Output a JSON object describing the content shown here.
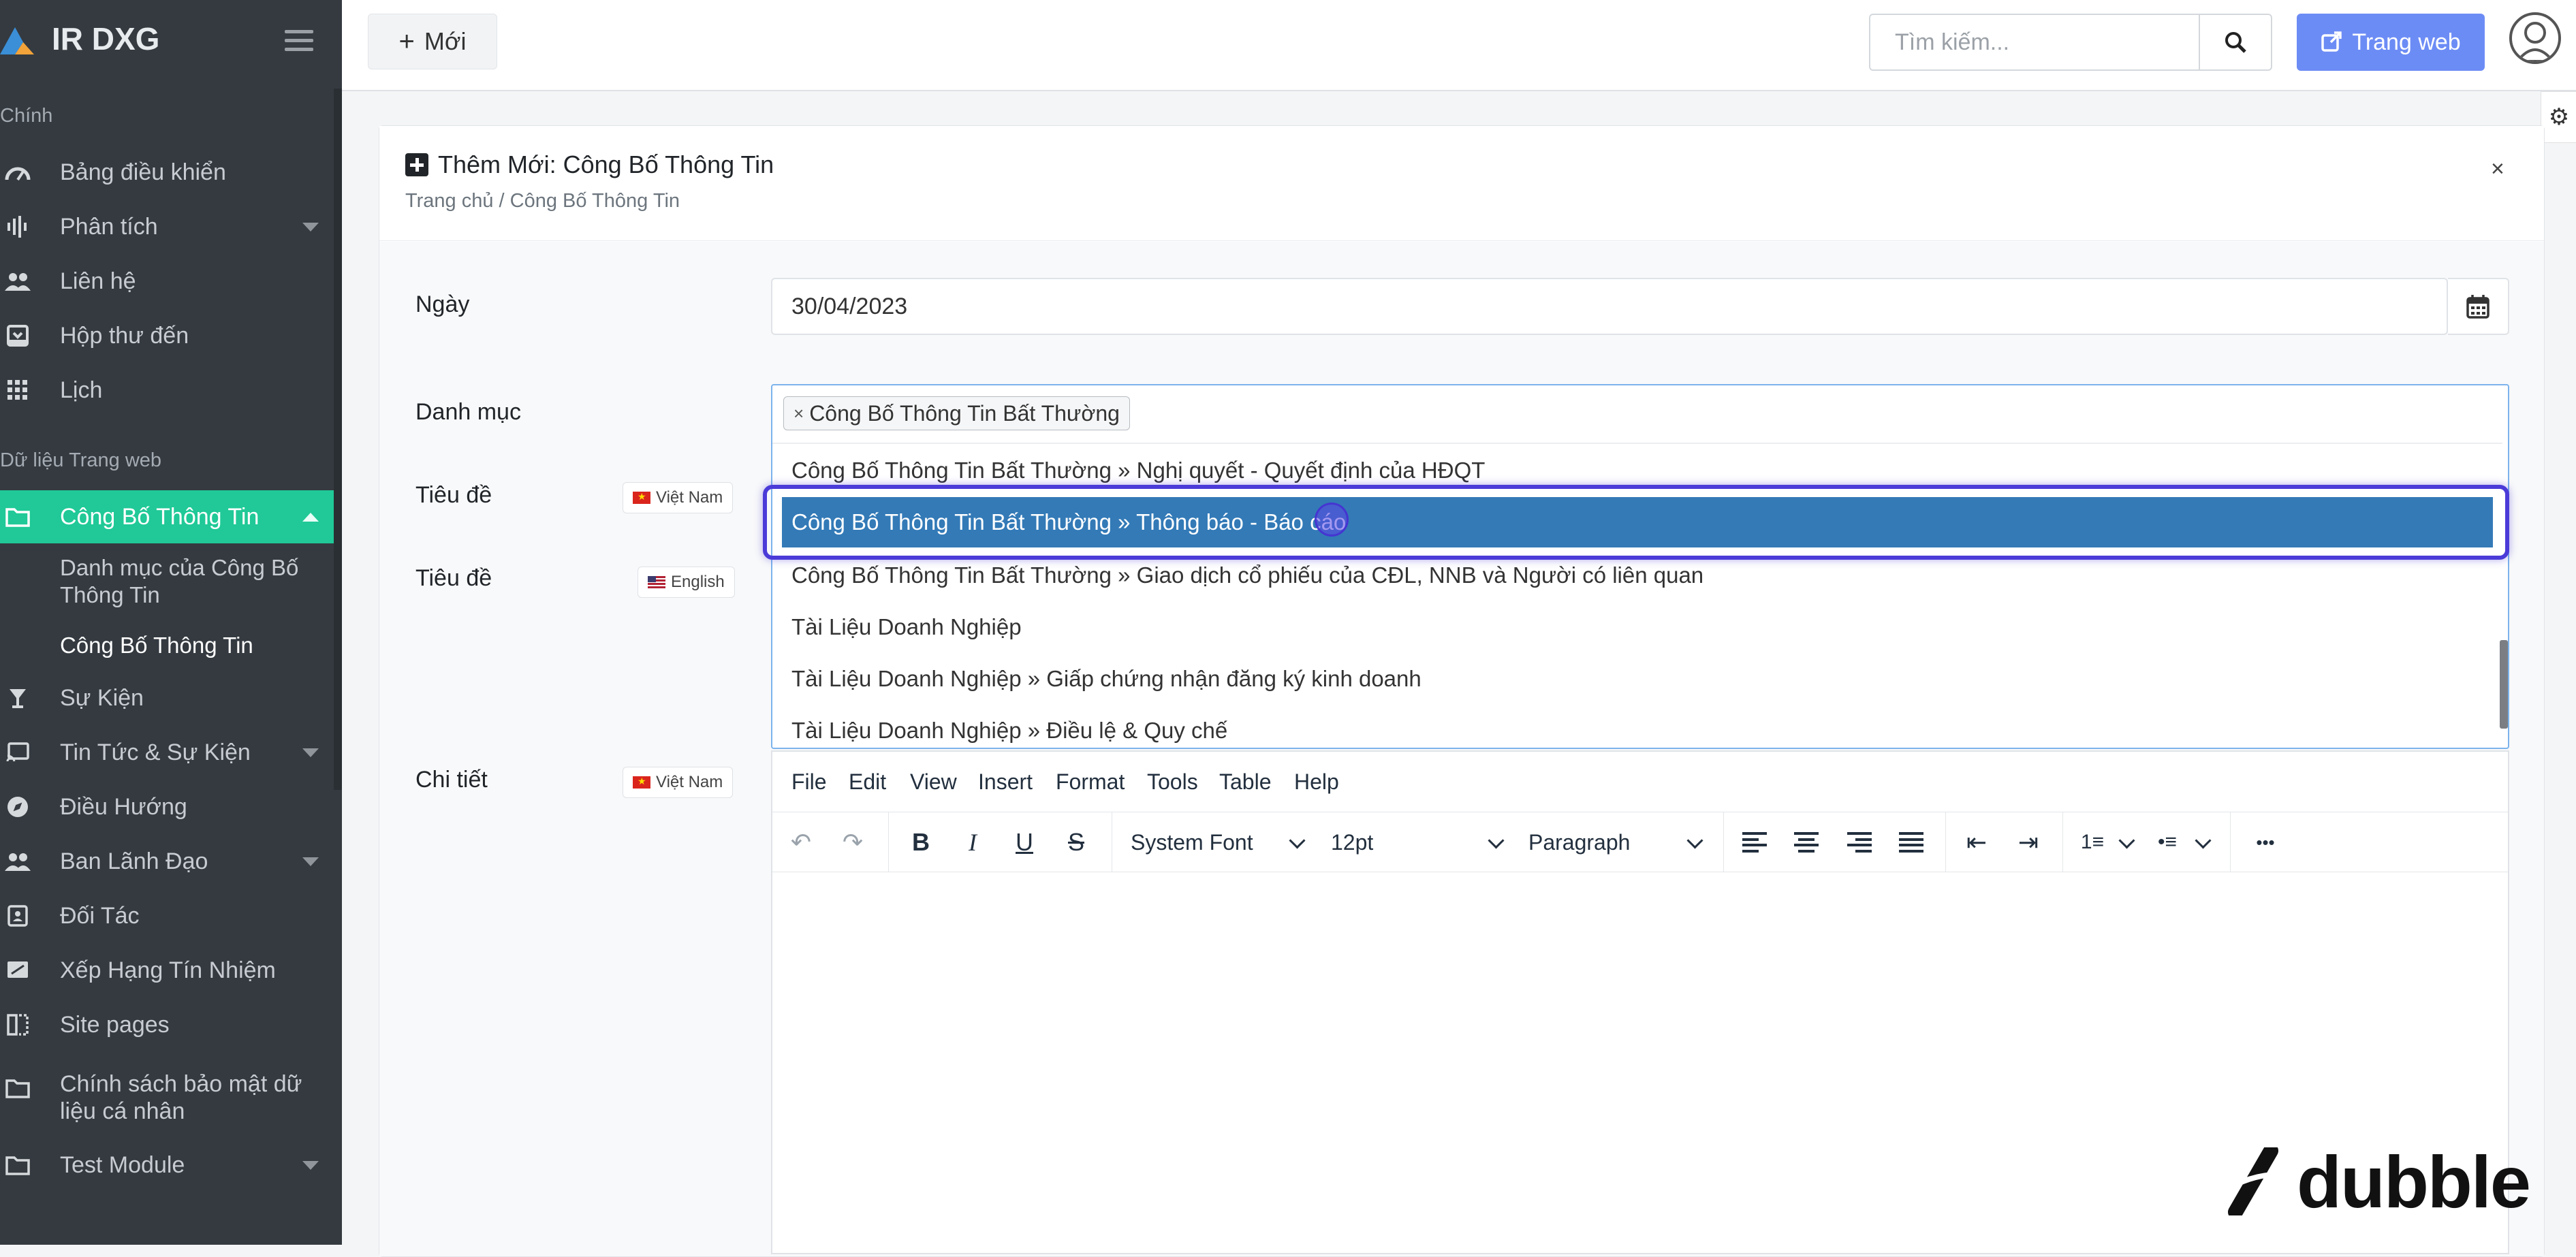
{
  "app": {
    "name": "IR DXG"
  },
  "sidebar": {
    "section_main": "Chính",
    "section_web": "Dữ liệu Trang web",
    "items_main": [
      {
        "label": "Bảng điều khiển",
        "icon": "dashboard-icon"
      },
      {
        "label": "Phân tích",
        "icon": "analytics-icon",
        "caret": true
      },
      {
        "label": "Liên hệ",
        "icon": "contacts-icon"
      },
      {
        "label": "Hộp thư đến",
        "icon": "inbox-icon"
      },
      {
        "label": "Lịch",
        "icon": "calendar-grid-icon"
      }
    ],
    "active_item": {
      "label": "Công Bố Thông Tin",
      "icon": "folder-icon"
    },
    "sub_items": [
      {
        "label": "Danh mục của Công Bố Thông Tin"
      },
      {
        "label": "Công Bố Thông Tin"
      }
    ],
    "items_web": [
      {
        "label": "Sự Kiện",
        "icon": "trophy-icon"
      },
      {
        "label": "Tin Tức & Sự Kiện",
        "icon": "cast-icon",
        "caret": true
      },
      {
        "label": "Điều Hướng",
        "icon": "compass-icon"
      },
      {
        "label": "Ban Lãnh Đạo",
        "icon": "people-icon",
        "caret": true
      },
      {
        "label": "Đối Tác",
        "icon": "contact-card-icon"
      },
      {
        "label": "Xếp Hạng Tín Nhiệm",
        "icon": "signature-icon"
      },
      {
        "label": "Site pages",
        "icon": "pages-icon"
      },
      {
        "label": "Chính sách bảo mật dữ liệu cá nhân",
        "icon": "folder-icon"
      },
      {
        "label": "Test Module",
        "icon": "folder-icon",
        "caret": true
      }
    ]
  },
  "topbar": {
    "new_label": "Mới",
    "search_placeholder": "Tìm kiếm...",
    "web_label": "Trang web"
  },
  "card": {
    "title": "Thêm Mới: Công Bố Thông Tin",
    "breadcrumb": "Trang chủ / Công Bố Thông Tin",
    "close": "×"
  },
  "form": {
    "date_label": "Ngày",
    "date_value": "30/04/2023",
    "category_label": "Danh mục",
    "title_label_vn": "Tiêu đề",
    "title_label_en": "Tiêu đề",
    "detail_label": "Chi tiết",
    "flag_vn": "Việt Nam",
    "flag_en": "English"
  },
  "category_select": {
    "selected_tag": "Công Bố Thông Tin Bất Thường",
    "options": [
      "Công Bố Thông Tin Bất Thường » Nghị quyết - Quyết định của HĐQT",
      "Công Bố Thông Tin Bất Thường » Thông báo - Báo cáo",
      "Công Bố Thông Tin Bất Thường » Giao dịch cổ phiếu của CĐL, NNB và Người có liên quan",
      "Tài Liệu Doanh Nghiệp",
      "Tài Liệu Doanh Nghiệp » Giấp chứng nhận đăng ký kinh doanh",
      "Tài Liệu Doanh Nghiệp » Điều lệ & Quy chế"
    ],
    "highlighted_index": 1
  },
  "editor": {
    "menu": [
      "File",
      "Edit",
      "View",
      "Insert",
      "Format",
      "Tools",
      "Table",
      "Help"
    ],
    "font_family": "System Font",
    "font_size": "12pt",
    "block_format": "Paragraph",
    "more": "•••"
  },
  "watermark": "dubble",
  "colors": {
    "sidebar_bg": "#343a40",
    "active_item": "#20c997",
    "highlight_option": "#337ab7",
    "web_button": "#6c8cf5",
    "focus_ring": "#4b3bd8"
  }
}
